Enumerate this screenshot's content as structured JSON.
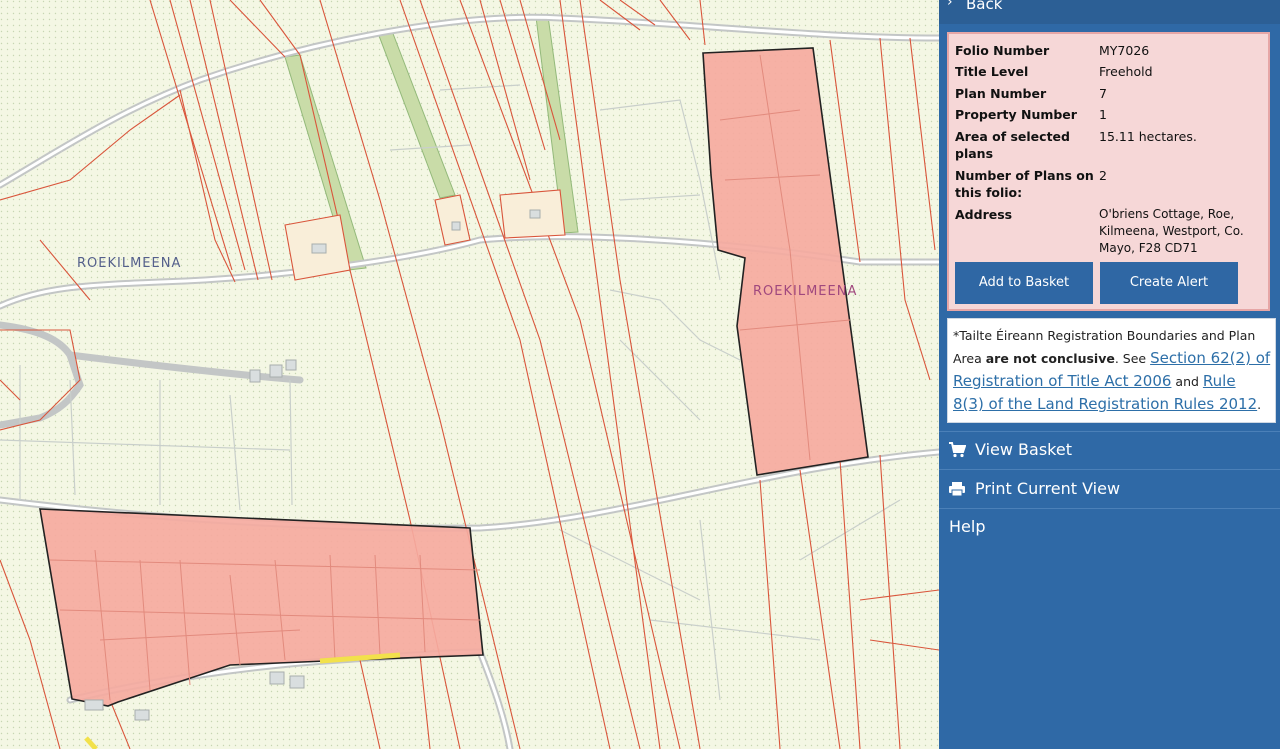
{
  "map": {
    "townland_labels": [
      "ROEKILMEENA",
      "ROEKILMEENA"
    ]
  },
  "panel": {
    "back_label": "Back",
    "details": [
      {
        "label": "Folio Number",
        "value": "MY7026"
      },
      {
        "label": "Title Level",
        "value": "Freehold"
      },
      {
        "label": "Plan Number",
        "value": "7"
      },
      {
        "label": "Property Number",
        "value": "1"
      },
      {
        "label": "Area of selected plans",
        "value": "15.11 hectares."
      },
      {
        "label": "Number of Plans on this folio:",
        "value": "2"
      },
      {
        "label": "Address",
        "value": "O'briens Cottage, Roe, Kilmeena, Westport, Co. Mayo, F28 CD71"
      }
    ],
    "add_to_basket": "Add to Basket",
    "create_alert": "Create Alert",
    "disclaimer": {
      "prefix": "*Tailte Éireann Registration Boundaries and Plan Area ",
      "bold": "are not conclusive",
      "mid": ". See ",
      "link1": "Section 62(2) of Registration of Title Act 2006",
      "and": " and ",
      "link2": "Rule 8(3) of the Land Registration Rules 2012",
      "end": "."
    },
    "menu": {
      "view_basket": "View Basket",
      "print_view": "Print Current View",
      "help": "Help"
    }
  },
  "colors": {
    "panel_bg": "#2f69a6",
    "info_bg": "#f6d7d7",
    "parcel_fill": "#f5aa9f",
    "boundary": "#d9553b",
    "map_bg": "#f4f7e4"
  }
}
